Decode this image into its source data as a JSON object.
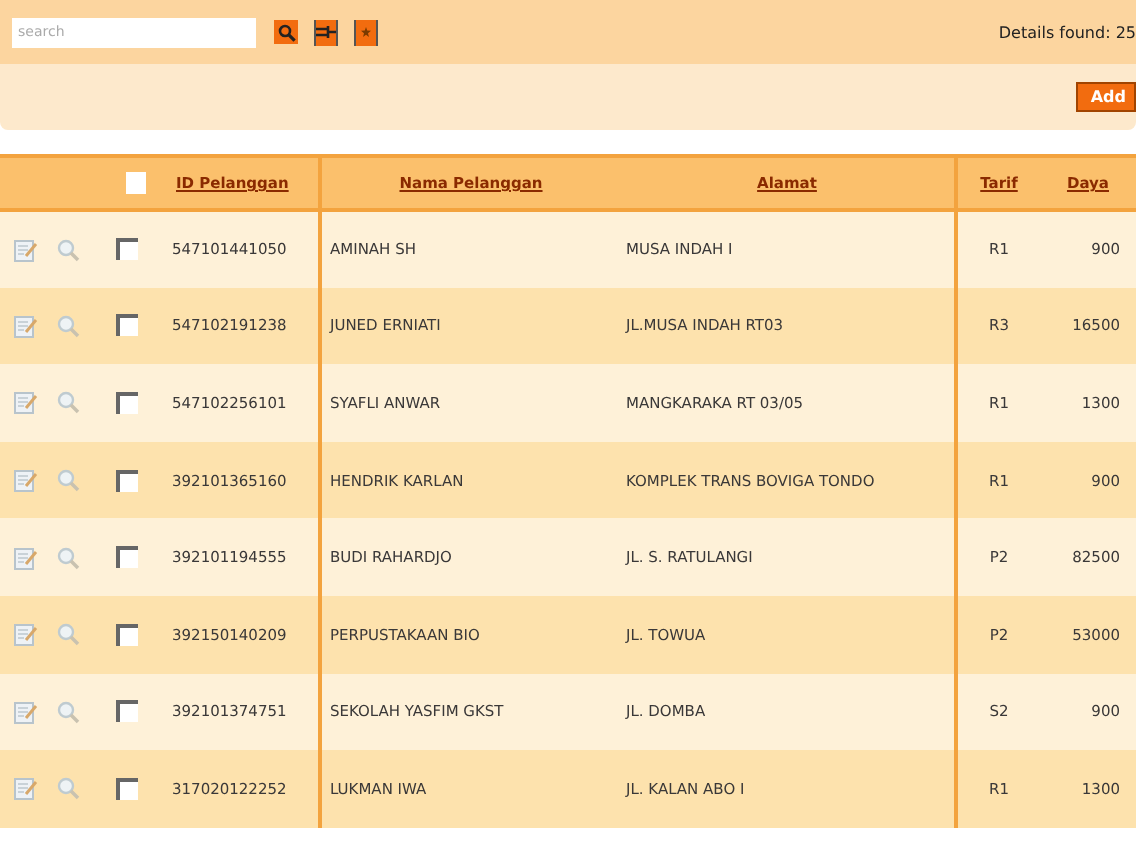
{
  "toolbar": {
    "search": {
      "placeholder": "search"
    },
    "details": "Details found: 25"
  },
  "action_bar": {
    "add_button": "Add"
  },
  "table": {
    "select_all": {
      "checked": false
    },
    "columns": [
      "ID Pelanggan",
      "Nama Pelanggan",
      "Alamat",
      "Tarif",
      "Daya"
    ],
    "rows": [
      {
        "checked": false,
        "cells": [
          "547101441050",
          "AMINAH SH",
          "MUSA INDAH I",
          "R1",
          "900"
        ]
      },
      {
        "checked": false,
        "cells": [
          "547102191238",
          "JUNED ERNIATI",
          "JL.MUSA INDAH RT03",
          "R3",
          "16500"
        ]
      },
      {
        "checked": false,
        "cells": [
          "547102256101",
          "SYAFLI ANWAR",
          "MANGKARAKA RT 03/05",
          "R1",
          "1300"
        ]
      },
      {
        "checked": false,
        "cells": [
          "392101365160",
          "HENDRIK KARLAN",
          "KOMPLEK TRANS BOVIGA TONDO",
          "R1",
          "900"
        ]
      },
      {
        "checked": false,
        "cells": [
          "392101194555",
          "BUDI RAHARDJO",
          "JL. S. RATULANGI",
          "P2",
          "82500"
        ]
      },
      {
        "checked": false,
        "cells": [
          "392150140209",
          "PERPUSTAKAAN BIO",
          "JL. TOWUA",
          "P2",
          "53000"
        ]
      },
      {
        "checked": false,
        "cells": [
          "392101374751",
          "SEKOLAH YASFIM GKST",
          "JL. DOMBA",
          "S2",
          "900"
        ]
      },
      {
        "checked": false,
        "cells": [
          "317020122252",
          "LUKMAN IWA",
          "JL. KALAN ABO I",
          "R1",
          "1300"
        ]
      }
    ]
  }
}
